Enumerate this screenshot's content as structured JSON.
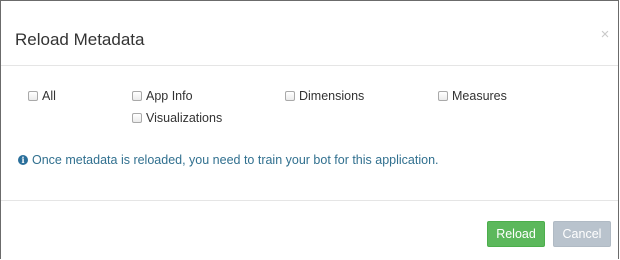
{
  "dialog": {
    "title": "Reload Metadata",
    "close_glyph": "×"
  },
  "options": [
    {
      "label": "All",
      "checked": false
    },
    {
      "label": "App Info",
      "checked": false
    },
    {
      "label": "Dimensions",
      "checked": false
    },
    {
      "label": "Measures",
      "checked": false
    },
    {
      "label": "Visualizations",
      "checked": false
    }
  ],
  "info": {
    "icon": "info-circle-icon",
    "text": "Once metadata is reloaded, you need to train your bot for this application."
  },
  "footer": {
    "reload_label": "Reload",
    "cancel_label": "Cancel"
  },
  "colors": {
    "reload_bg": "#5cb85c",
    "cancel_bg": "#b9c3cd",
    "info_text": "#31708f"
  }
}
